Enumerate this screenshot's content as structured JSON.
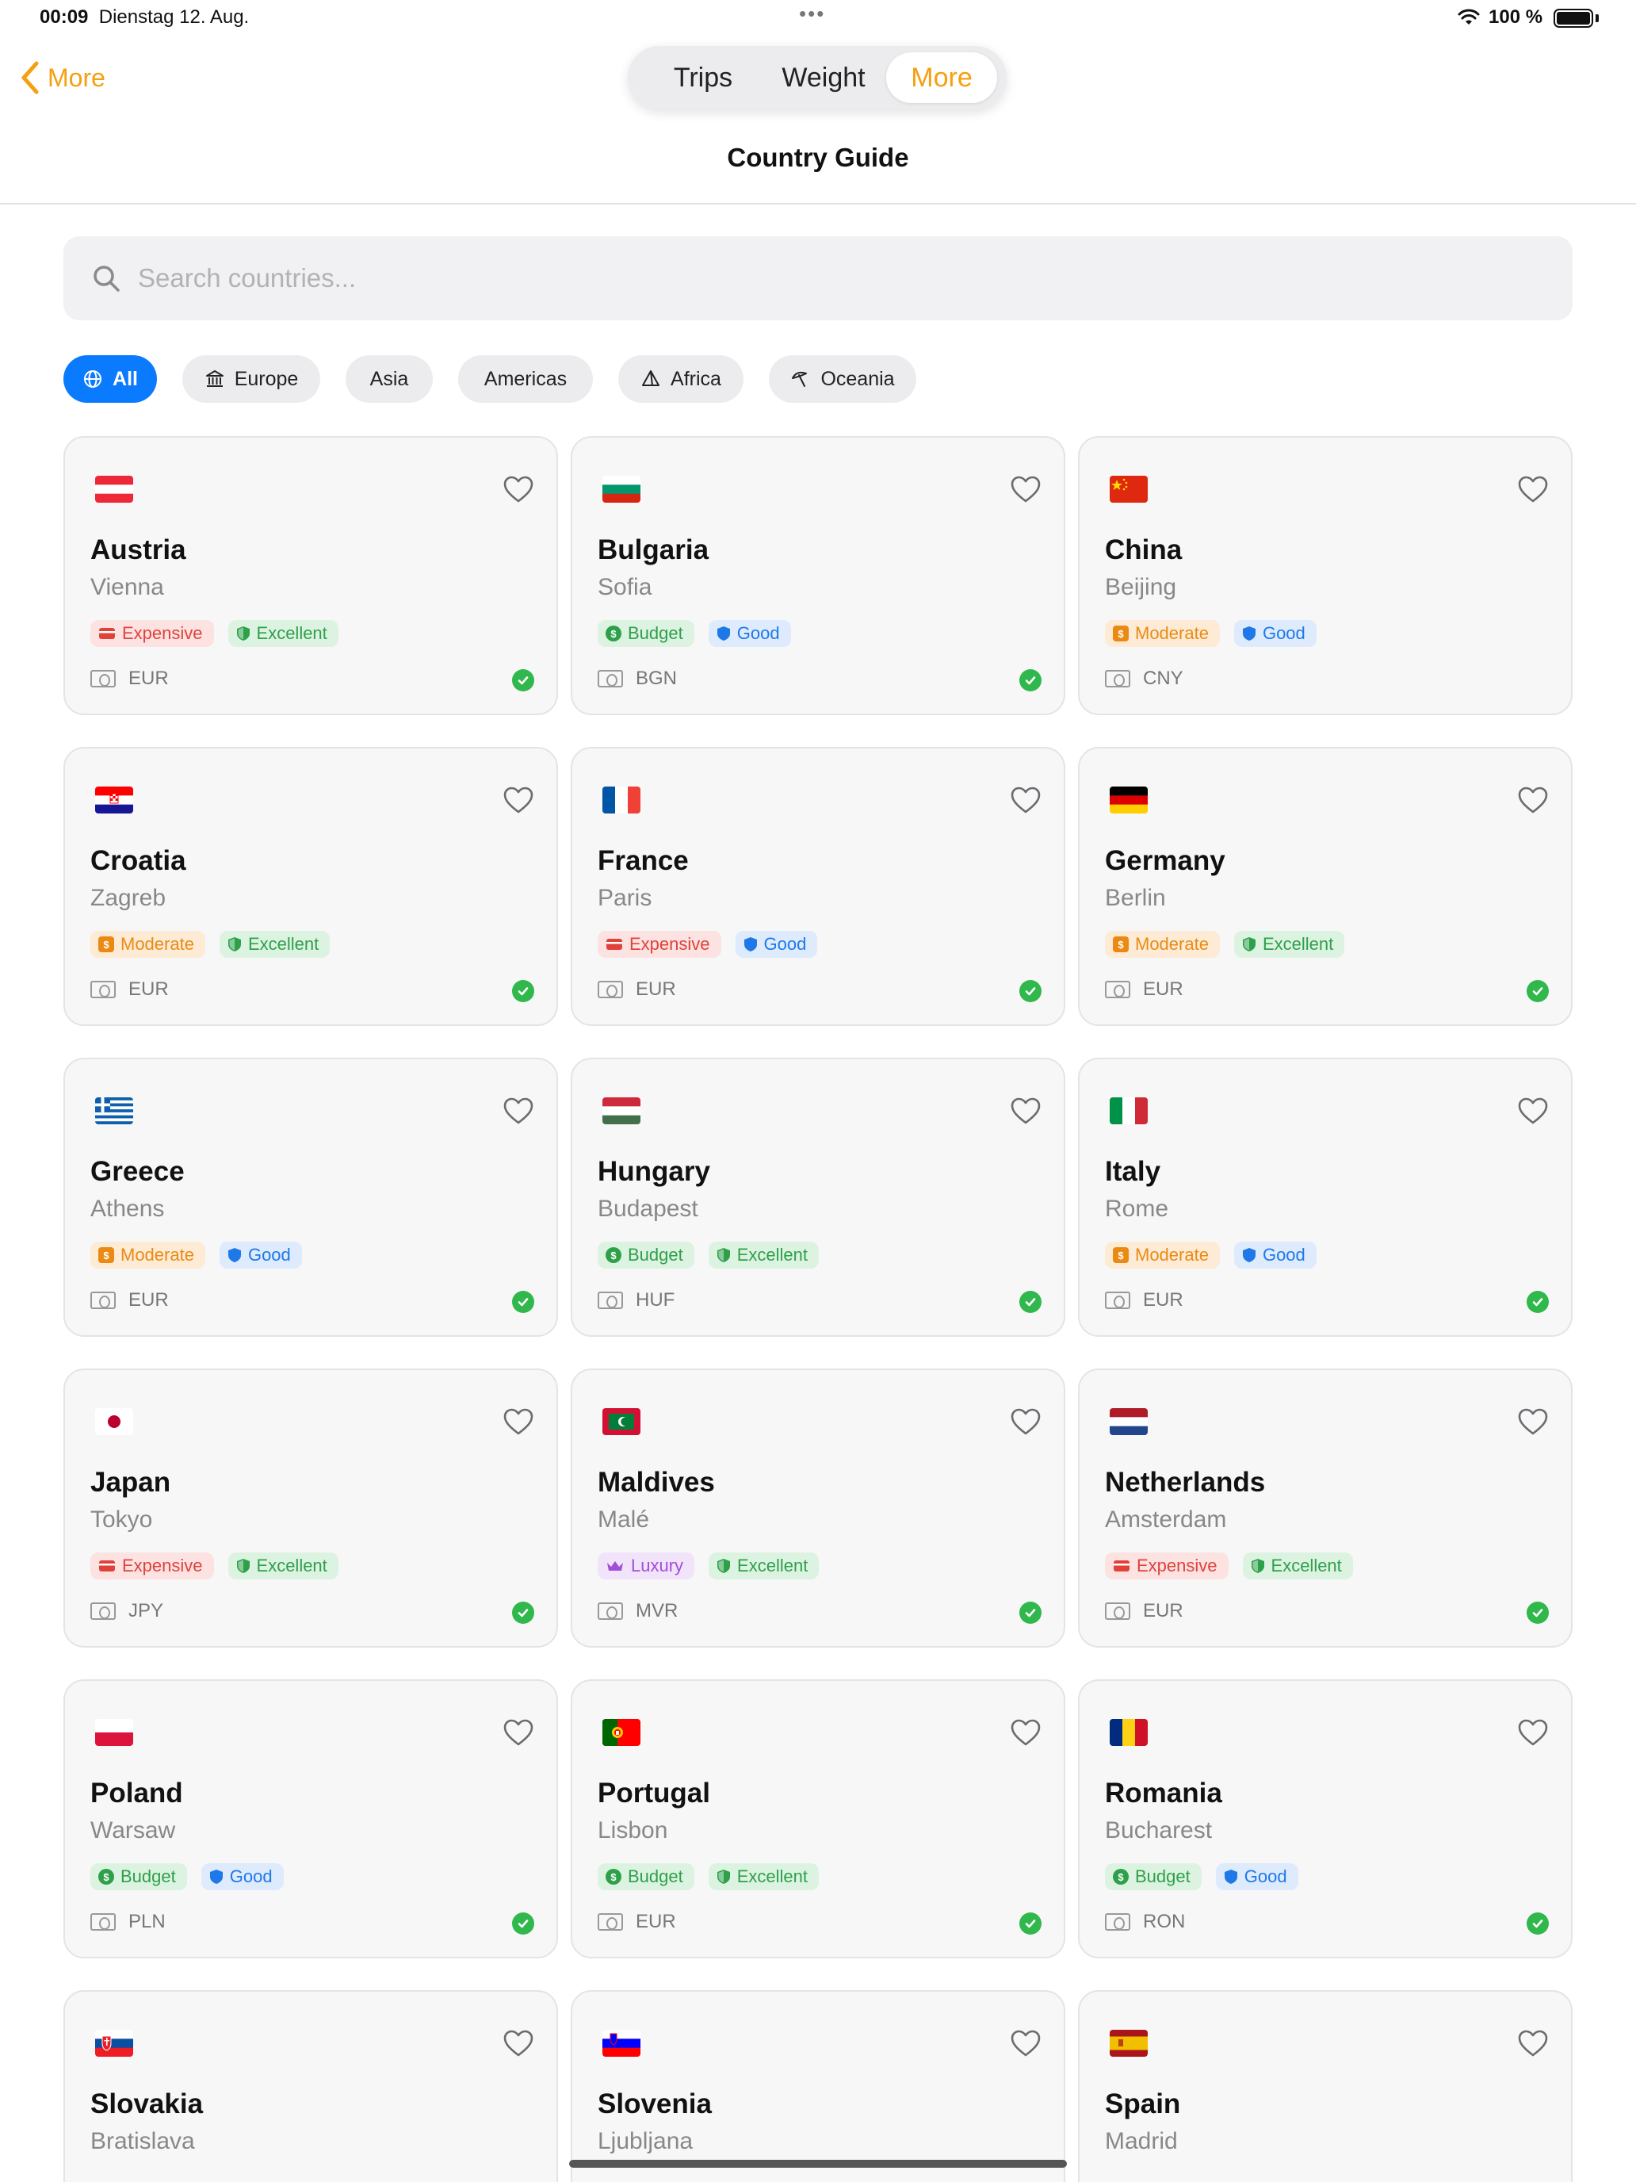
{
  "status_bar": {
    "time": "00:09",
    "date": "Dienstag 12. Aug.",
    "battery": "100 %"
  },
  "nav": {
    "back_label": "More",
    "segments": [
      "Trips",
      "Weight",
      "More"
    ],
    "selected_segment": "More",
    "title": "Country Guide"
  },
  "search": {
    "placeholder": "Search countries...",
    "value": ""
  },
  "filters": [
    {
      "label": "All",
      "icon": "globe-icon",
      "active": true
    },
    {
      "label": "Europe",
      "icon": "building-columns-icon",
      "active": false
    },
    {
      "label": "Asia",
      "icon": "",
      "active": false
    },
    {
      "label": "Americas",
      "icon": "",
      "active": false
    },
    {
      "label": "Africa",
      "icon": "pyramid-icon",
      "active": false
    },
    {
      "label": "Oceania",
      "icon": "beach-umbrella-icon",
      "active": false
    }
  ],
  "badge_styles": {
    "Expensive": {
      "bg": "#FDE2E2",
      "fg": "#E0423A",
      "icon": "credit-card-icon"
    },
    "Budget": {
      "bg": "#DDF3E1",
      "fg": "#2EA04A",
      "icon": "dollar-circle-icon"
    },
    "Moderate": {
      "bg": "#FDEBD6",
      "fg": "#EB8A12",
      "icon": "dollar-square-icon"
    },
    "Luxury": {
      "bg": "#F1E3FA",
      "fg": "#A14FD8",
      "icon": "crown-icon"
    },
    "Excellent": {
      "bg": "#DDF3E1",
      "fg": "#2EA04A",
      "icon": "shield-check-icon"
    },
    "Good": {
      "bg": "#DDEBFD",
      "fg": "#1F78E8",
      "icon": "shield-icon"
    }
  },
  "countries": [
    {
      "name": "Austria",
      "capital": "Vienna",
      "cost": "Expensive",
      "safety": "Excellent",
      "currency": "EUR",
      "flag": "austria",
      "visited": true
    },
    {
      "name": "Bulgaria",
      "capital": "Sofia",
      "cost": "Budget",
      "safety": "Good",
      "currency": "BGN",
      "flag": "bulgaria",
      "visited": true
    },
    {
      "name": "China",
      "capital": "Beijing",
      "cost": "Moderate",
      "safety": "Good",
      "currency": "CNY",
      "flag": "china",
      "visited": false
    },
    {
      "name": "Croatia",
      "capital": "Zagreb",
      "cost": "Moderate",
      "safety": "Excellent",
      "currency": "EUR",
      "flag": "croatia",
      "visited": true
    },
    {
      "name": "France",
      "capital": "Paris",
      "cost": "Expensive",
      "safety": "Good",
      "currency": "EUR",
      "flag": "france",
      "visited": true
    },
    {
      "name": "Germany",
      "capital": "Berlin",
      "cost": "Moderate",
      "safety": "Excellent",
      "currency": "EUR",
      "flag": "germany",
      "visited": true
    },
    {
      "name": "Greece",
      "capital": "Athens",
      "cost": "Moderate",
      "safety": "Good",
      "currency": "EUR",
      "flag": "greece",
      "visited": true
    },
    {
      "name": "Hungary",
      "capital": "Budapest",
      "cost": "Budget",
      "safety": "Excellent",
      "currency": "HUF",
      "flag": "hungary",
      "visited": true
    },
    {
      "name": "Italy",
      "capital": "Rome",
      "cost": "Moderate",
      "safety": "Good",
      "currency": "EUR",
      "flag": "italy",
      "visited": true
    },
    {
      "name": "Japan",
      "capital": "Tokyo",
      "cost": "Expensive",
      "safety": "Excellent",
      "currency": "JPY",
      "flag": "japan",
      "visited": true
    },
    {
      "name": "Maldives",
      "capital": "Malé",
      "cost": "Luxury",
      "safety": "Excellent",
      "currency": "MVR",
      "flag": "maldives",
      "visited": true
    },
    {
      "name": "Netherlands",
      "capital": "Amsterdam",
      "cost": "Expensive",
      "safety": "Excellent",
      "currency": "EUR",
      "flag": "netherlands",
      "visited": true
    },
    {
      "name": "Poland",
      "capital": "Warsaw",
      "cost": "Budget",
      "safety": "Good",
      "currency": "PLN",
      "flag": "poland",
      "visited": true
    },
    {
      "name": "Portugal",
      "capital": "Lisbon",
      "cost": "Budget",
      "safety": "Excellent",
      "currency": "EUR",
      "flag": "portugal",
      "visited": true
    },
    {
      "name": "Romania",
      "capital": "Bucharest",
      "cost": "Budget",
      "safety": "Good",
      "currency": "RON",
      "flag": "romania",
      "visited": true
    },
    {
      "name": "Slovakia",
      "capital": "Bratislava",
      "cost": "",
      "safety": "",
      "currency": "",
      "flag": "slovakia",
      "visited": false
    },
    {
      "name": "Slovenia",
      "capital": "Ljubljana",
      "cost": "",
      "safety": "",
      "currency": "",
      "flag": "slovenia",
      "visited": false
    },
    {
      "name": "Spain",
      "capital": "Madrid",
      "cost": "",
      "safety": "",
      "currency": "",
      "flag": "spain",
      "visited": false
    }
  ]
}
